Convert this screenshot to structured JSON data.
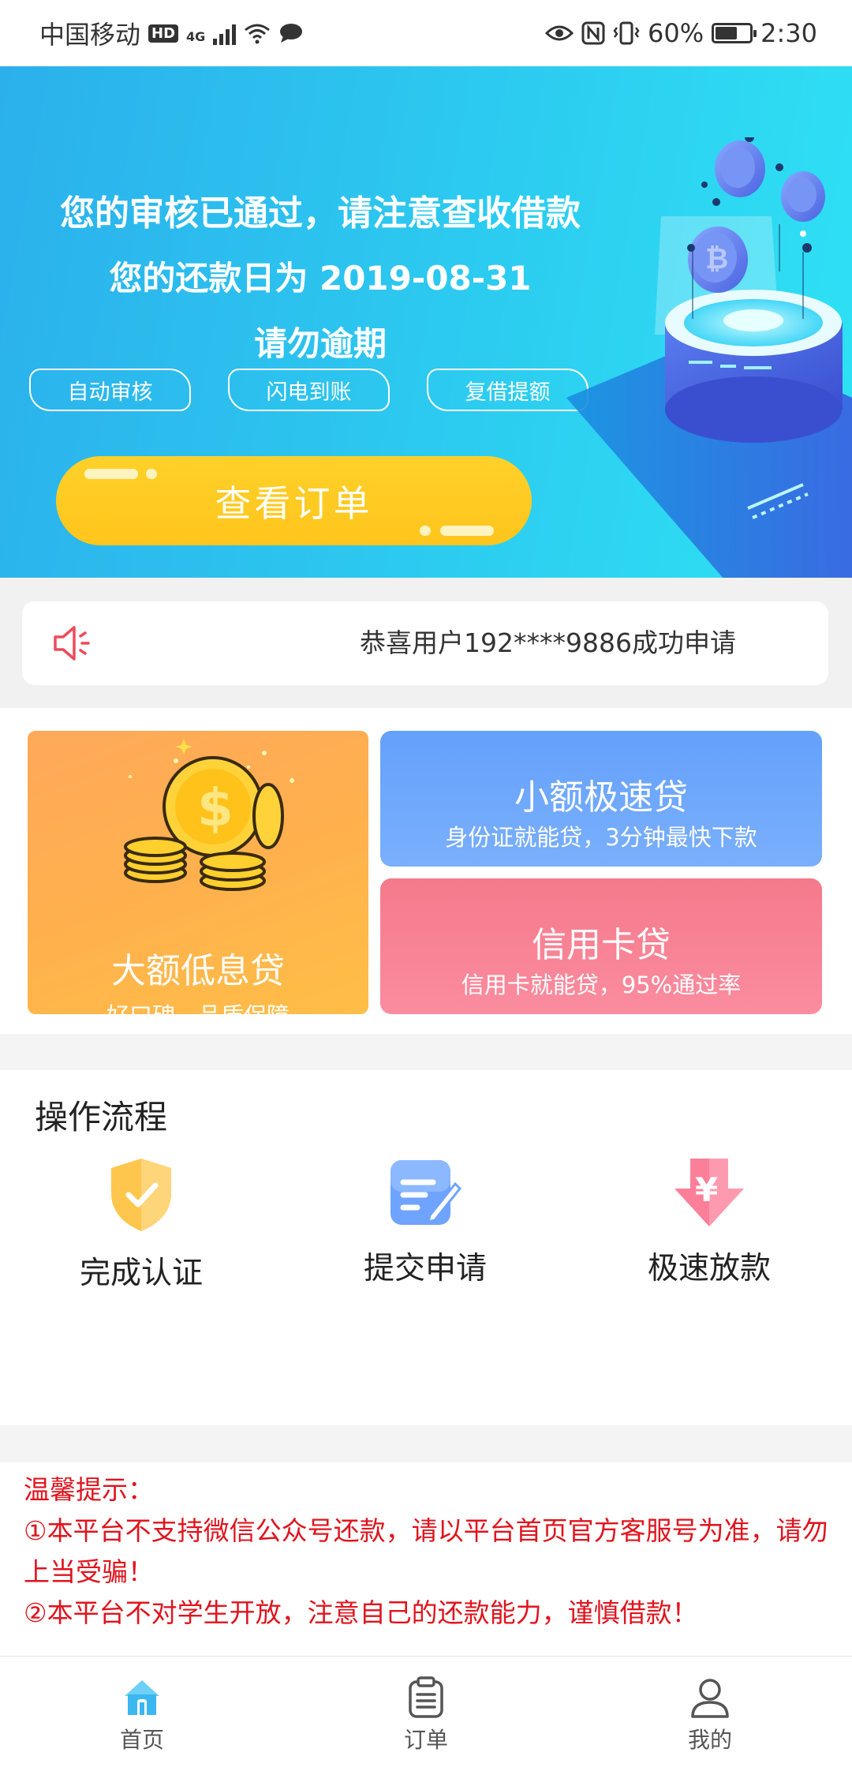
{
  "status_bar": {
    "carrier": "中国移动",
    "hd": "HD",
    "network": "4G",
    "battery": "60%",
    "battery_level": 0.6,
    "time": "2:30"
  },
  "banner": {
    "line1": "您的审核已通过，请注意查收借款",
    "line2": "您的还款日为 2019-08-31",
    "line3": "请勿逾期",
    "tags": [
      "自动审核",
      "闪电到账",
      "复借提额"
    ],
    "button_label": "查看订单"
  },
  "notice": {
    "text": "恭喜用户192****9886成功申请"
  },
  "products": {
    "big": {
      "title": "大额低息贷",
      "subtitle": "好口碑，品质保障"
    },
    "small_fast": {
      "title": "小额极速贷",
      "subtitle": "身份证就能贷，3分钟最快下款"
    },
    "credit_card": {
      "title": "信用卡贷",
      "subtitle": "信用卡就能贷，95%通过率"
    }
  },
  "process": {
    "title": "操作流程",
    "steps": [
      {
        "label": "完成认证",
        "icon": "shield-check-icon"
      },
      {
        "label": "提交申请",
        "icon": "form-edit-icon"
      },
      {
        "label": "极速放款",
        "icon": "yuan-down-arrow-icon"
      }
    ]
  },
  "tips": {
    "heading": "温馨提示：",
    "item1": "①本平台不支持微信公众号还款，请以平台首页官方客服号为准，请勿上当受骗！",
    "item2": "②本平台不对学生开放，注意自己的还款能力，谨慎借款！"
  },
  "tabbar": {
    "tabs": [
      {
        "label": "首页",
        "icon": "home-icon",
        "active": true
      },
      {
        "label": "订单",
        "icon": "clipboard-icon",
        "active": false
      },
      {
        "label": "我的",
        "icon": "user-icon",
        "active": false
      }
    ]
  },
  "colors": {
    "banner_blue": "#2bb0ec",
    "button_yellow": "#ffc51c",
    "card_orange": "#ffb04d",
    "card_blue": "#6aa6fb",
    "card_pink": "#f7849a",
    "tip_red": "#e0141e",
    "active_tab": "#3ab6f0"
  }
}
